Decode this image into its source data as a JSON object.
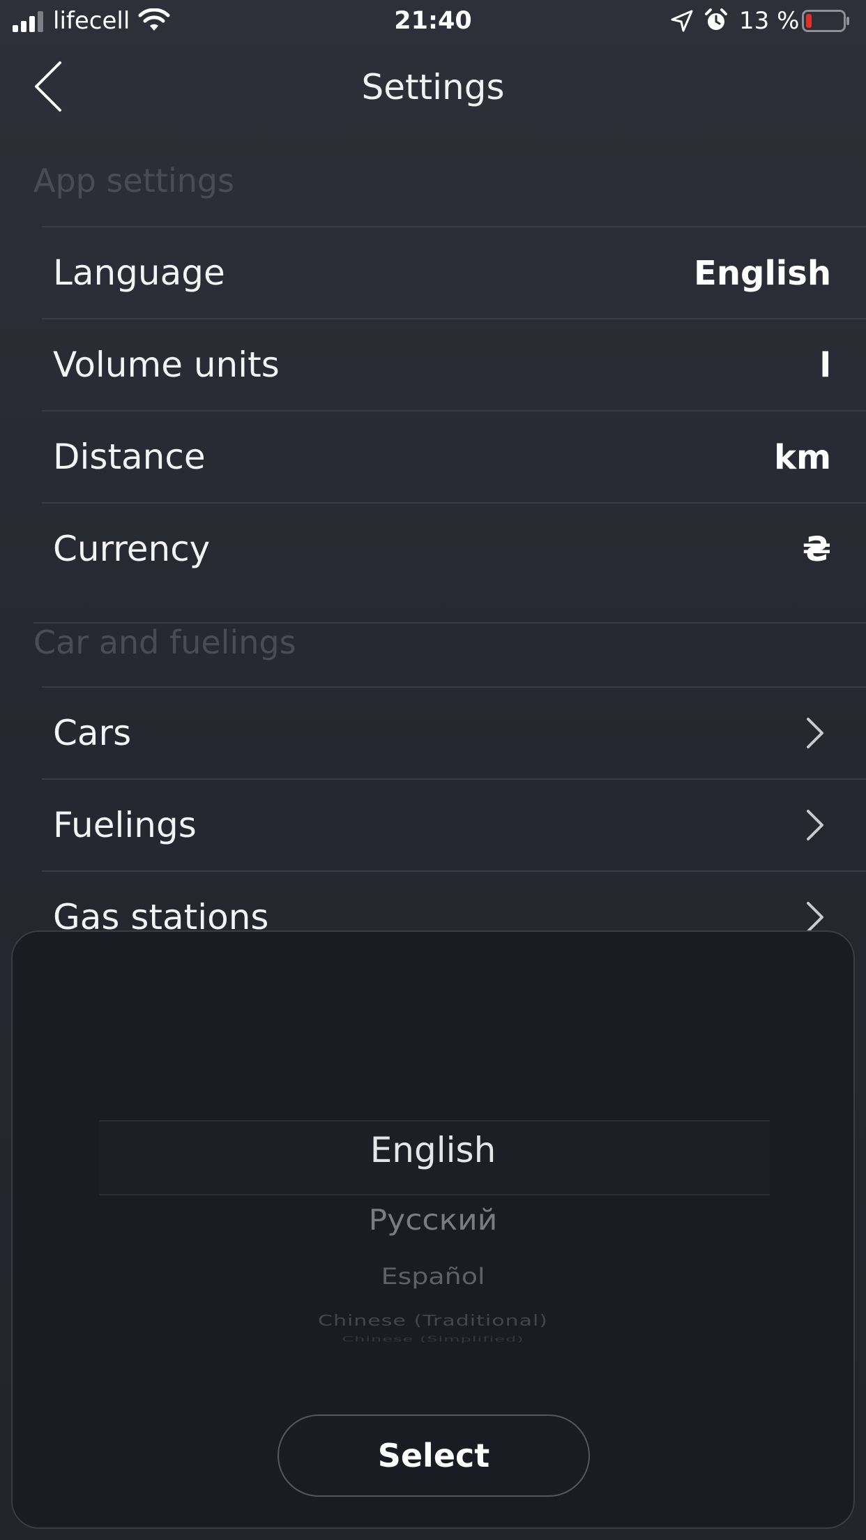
{
  "status_bar": {
    "carrier": "lifecell",
    "time": "21:40",
    "battery_percent": "13 %",
    "battery_level": 0.13,
    "icons": [
      "signal-icon",
      "wifi-icon",
      "location-icon",
      "alarm-icon",
      "battery-icon"
    ]
  },
  "nav": {
    "title": "Settings",
    "back_icon": "back-chevron-icon"
  },
  "sections": {
    "app_settings": {
      "header": "App settings",
      "rows": [
        {
          "label": "Language",
          "value": "English"
        },
        {
          "label": "Volume units",
          "value": "l"
        },
        {
          "label": "Distance",
          "value": "km"
        },
        {
          "label": "Currency",
          "value": "₴"
        }
      ]
    },
    "car_and_fuelings": {
      "header": "Car and fuelings",
      "rows": [
        {
          "label": "Cars",
          "icon": "chevron-right-icon"
        },
        {
          "label": "Fuelings",
          "icon": "chevron-right-icon"
        },
        {
          "label": "Gas stations",
          "icon": "chevron-right-icon"
        }
      ]
    }
  },
  "picker": {
    "options": [
      "English",
      "Русский",
      "Español",
      "Chinese (Traditional)",
      "Chinese (Simplified)"
    ],
    "selected": "English",
    "button_label": "Select"
  },
  "colors": {
    "background": "#2b2c35",
    "sheet": "#1b1c23",
    "section_header": "#4a4b55",
    "battery_low": "#e0302a"
  }
}
